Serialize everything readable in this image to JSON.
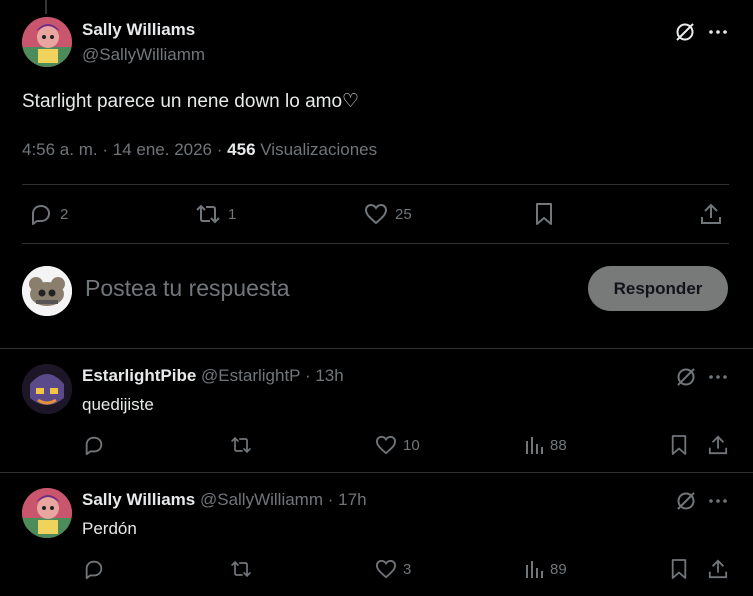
{
  "main_post": {
    "author_name": "Sally Williams",
    "author_handle": "@SallyWilliamm",
    "text": "Starlight parece un nene down lo amo♡",
    "time": "4:56 a. m.",
    "date": "14 ene. 2026",
    "views_count": "456",
    "views_label": "Visualizaciones",
    "replies": "2",
    "reposts": "1",
    "likes": "25"
  },
  "composer": {
    "placeholder": "Postea tu respuesta",
    "reply_button": "Responder"
  },
  "replies": [
    {
      "author_name": "EstarlightPibe",
      "author_handle": "@EstarlightP",
      "time": "13h",
      "text": "quedijiste",
      "replies": "",
      "reposts": "",
      "likes": "10",
      "views": "88"
    },
    {
      "author_name": "Sally Williams",
      "author_handle": "@SallyWilliamm",
      "time": "17h",
      "text": "Perdón",
      "replies": "",
      "reposts": "",
      "likes": "3",
      "views": "89"
    }
  ],
  "separators": {
    "dot": "·"
  },
  "colors": {
    "background": "#000000",
    "text": "#e7e9ea",
    "muted": "#71767b",
    "divider": "#2f3336",
    "button": "#787a7a"
  }
}
